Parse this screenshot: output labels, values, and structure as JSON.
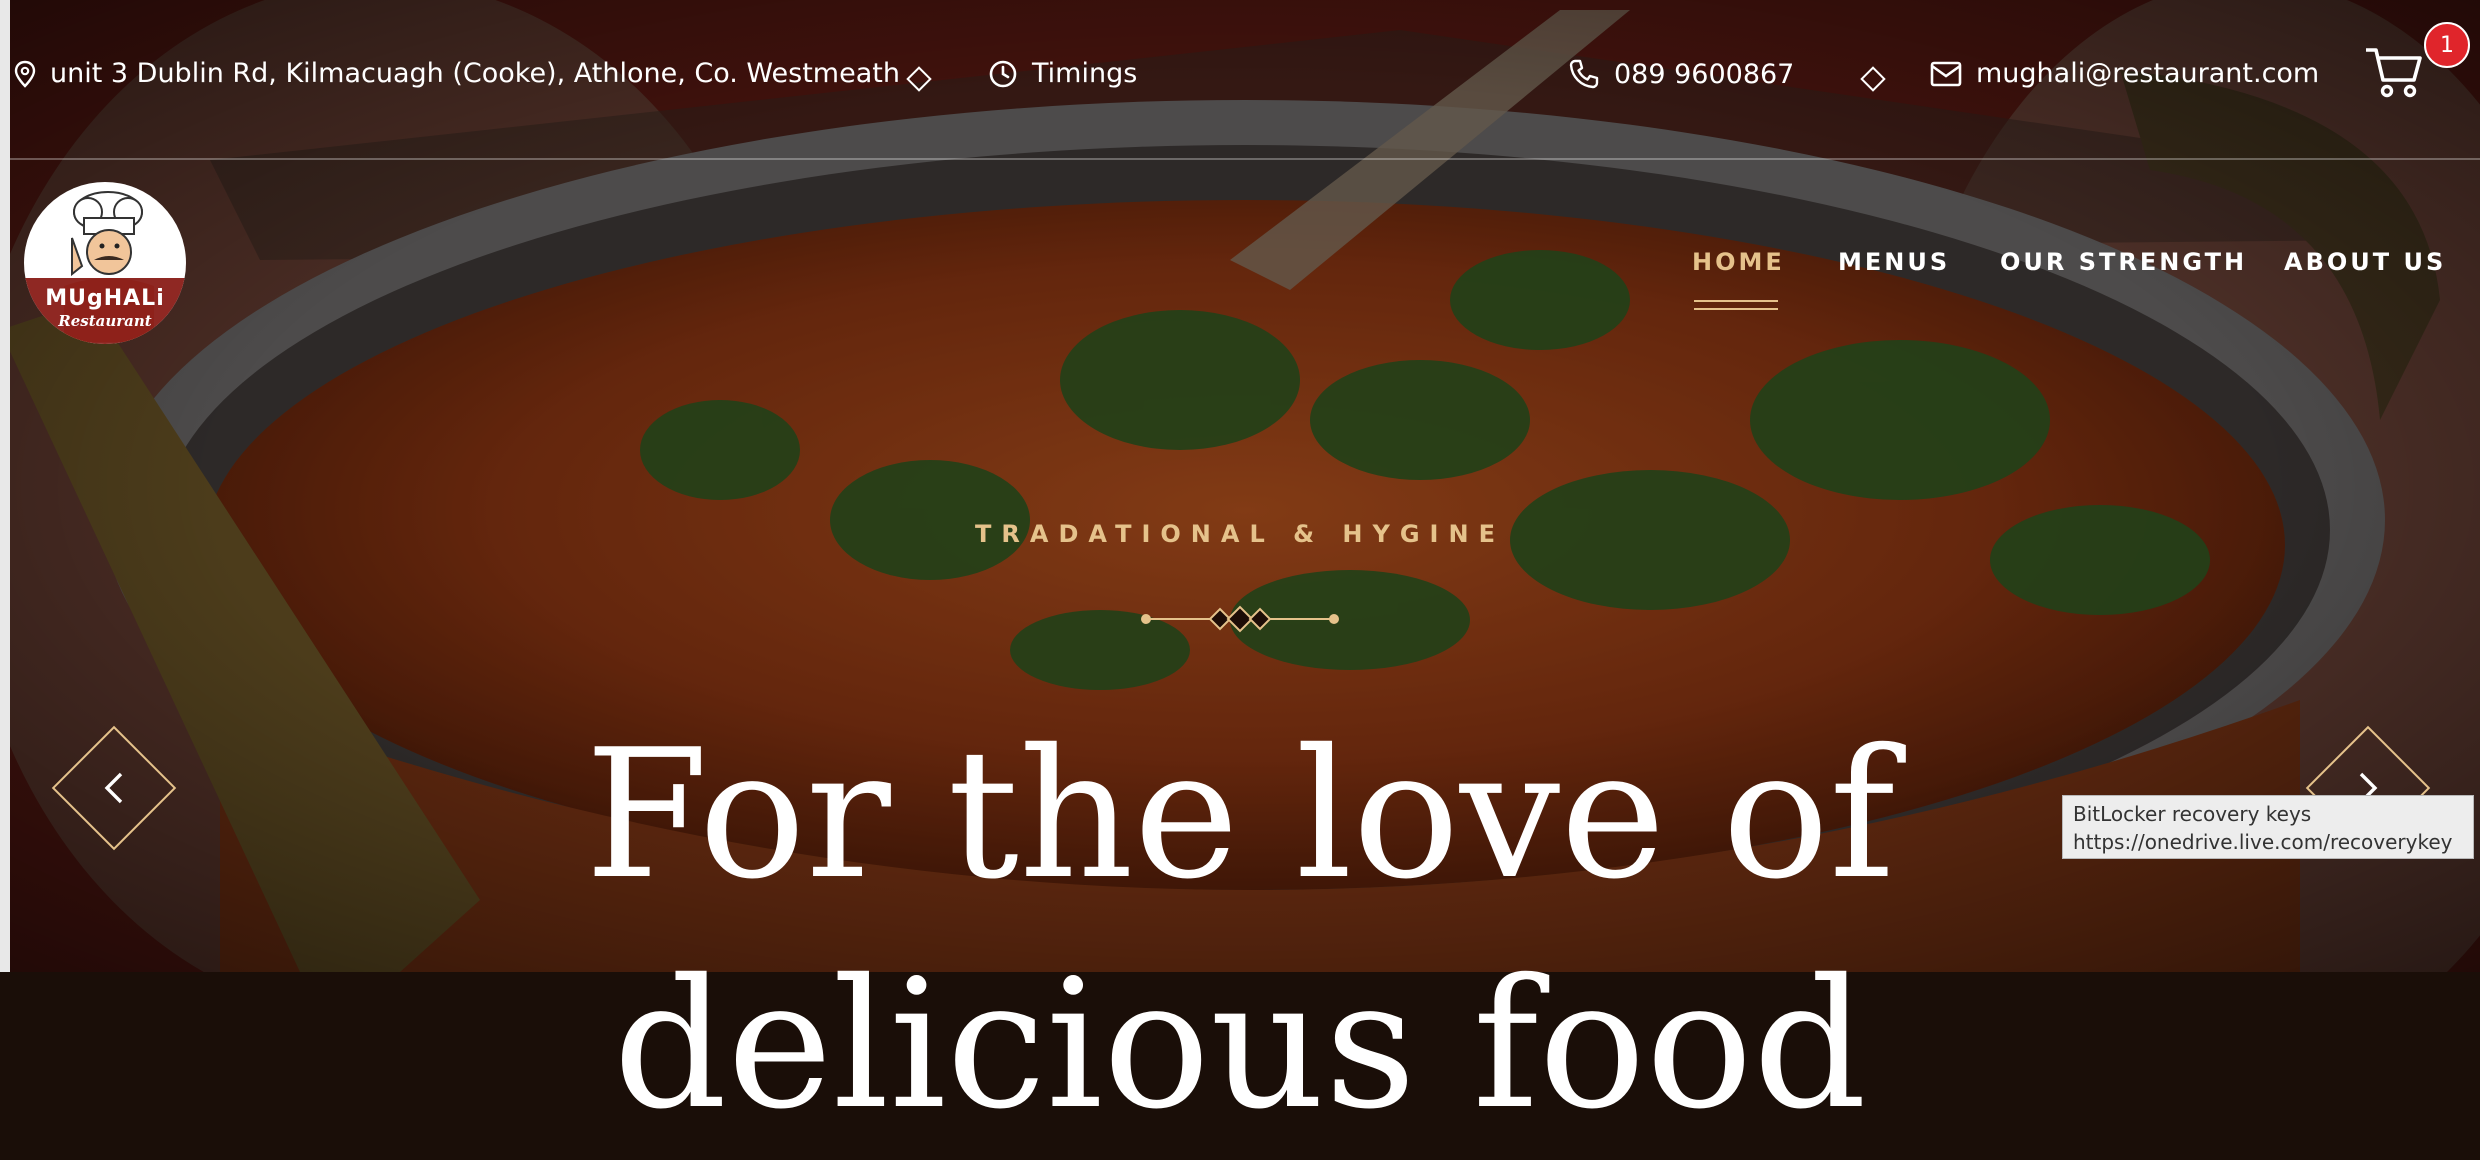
{
  "topbar": {
    "address": "unit 3 Dublin Rd, Kilmacuagh (Cooke), Athlone, Co. Westmeath",
    "timings": "Timings",
    "phone": "089 9600867",
    "email": "mughali@restaurant.com",
    "cart_count": "1",
    "icons": [
      "location-pin-icon",
      "clock-icon",
      "phone-icon",
      "mail-icon",
      "cart-icon"
    ]
  },
  "logo": {
    "name": "MUgHALi",
    "sub": "Restaurant"
  },
  "nav": {
    "items": [
      "HOME",
      "MENUS",
      "OUR STRENGTH",
      "ABOUT US"
    ],
    "active": "HOME"
  },
  "hero": {
    "kicker": "TRADATIONAL & HYGINE",
    "headline": "For the love of",
    "headline_line2": "delicious food"
  },
  "tooltip": {
    "title": "BitLocker recovery keys",
    "url": "https://onedrive.live.com/recoverykey"
  },
  "colors": {
    "accent": "#e5c28b",
    "badge": "#e0252b",
    "text": "#ffffff"
  }
}
